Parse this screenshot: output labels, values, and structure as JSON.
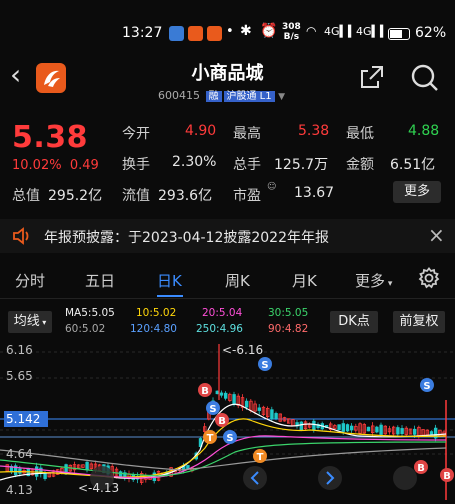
{
  "status_bar": {
    "time": "13:27",
    "net_speed": "308",
    "net_unit": "B/s",
    "battery": "62%"
  },
  "header": {
    "title": "小商品城",
    "code": "600415",
    "tag1": "融",
    "tag2": "沪股通 L1"
  },
  "quote": {
    "price": "5.38",
    "pct": "10.02%",
    "change": "0.49",
    "open_label": "今开",
    "open": "4.90",
    "high_label": "最高",
    "high": "5.38",
    "low_label": "最低",
    "low": "4.88",
    "turnover_label": "换手",
    "turnover": "2.30%",
    "volume_label": "总手",
    "volume": "125.7万",
    "amount_label": "金额",
    "amount": "6.51亿",
    "mktcap_label": "总值",
    "mktcap": "295.2亿",
    "float_label": "流值",
    "float": "293.6亿",
    "pe_label": "市盈",
    "pe": "13.67",
    "more": "更多"
  },
  "notice": {
    "text": "年报预披露：于2023-04-12披露2022年年报"
  },
  "tabs": [
    "分时",
    "五日",
    "日K",
    "周K",
    "月K",
    "更多"
  ],
  "indicators": {
    "ma_button": "均线",
    "ma5": "MA5:5.05",
    "ma10": "10:5.02",
    "ma20": "20:5.04",
    "ma30": "30:5.05",
    "ma60": "60:5.02",
    "ma120": "120:4.80",
    "ma250": "250:4.96",
    "ma90": "90:4.82",
    "dk_button": "DK点",
    "adjust_button": "前复权"
  },
  "chart_data": {
    "type": "candlestick",
    "y_ticks": [
      "6.16",
      "5.65",
      "4.64",
      "4.13"
    ],
    "cursor_label": "5.142",
    "max_annot": "6.16",
    "min_annot": "4.13",
    "colors": {
      "up": "#ff3b3b",
      "down": "#1fc7c7",
      "ma5": "#ffffff",
      "ma10": "#ffd60a",
      "ma20": "#ff4fd8",
      "ma30": "#3bd46b",
      "ma60": "#9a9a9a"
    }
  }
}
